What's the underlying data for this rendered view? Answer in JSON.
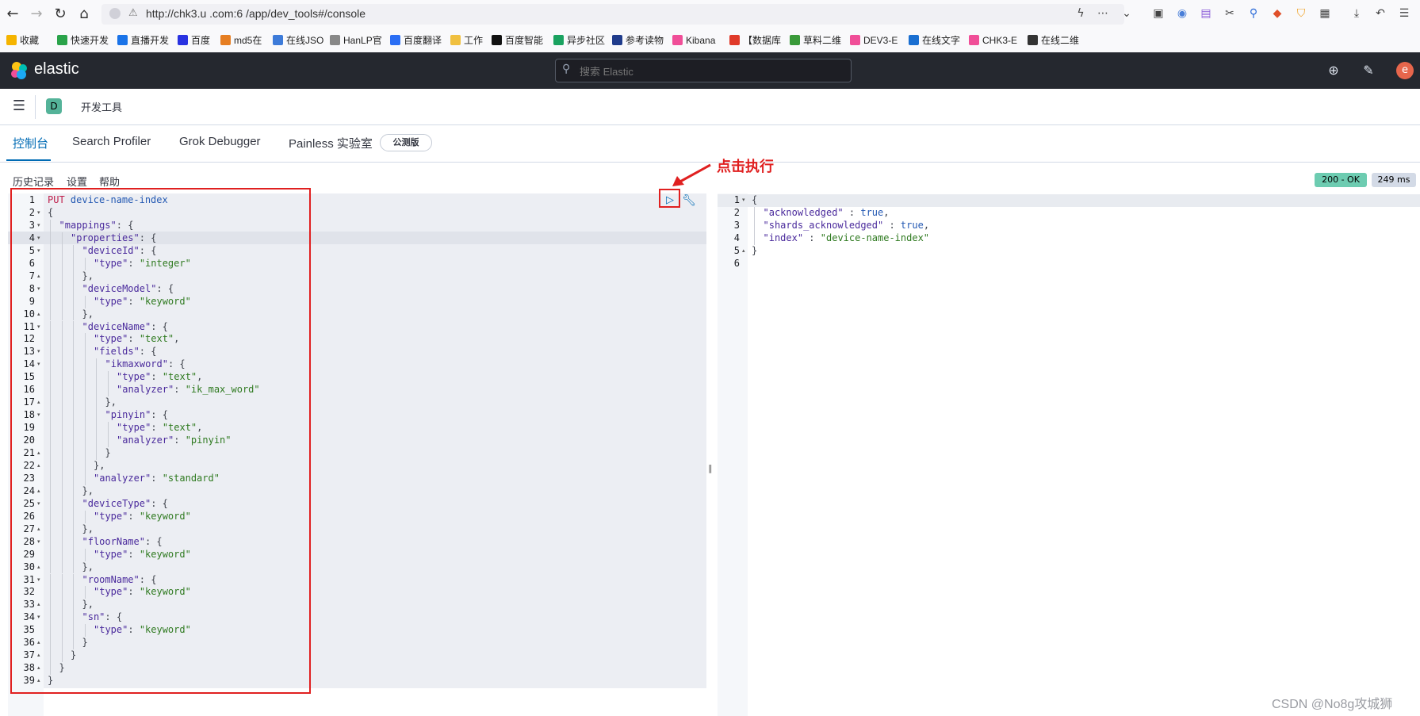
{
  "browser": {
    "back": "←",
    "forward": "→",
    "reload": "↻",
    "home": "⌂",
    "url": "http://chk3.u    .com:6   /app/dev_tools#/console",
    "toolbar_icons": [
      "bolt-icon",
      "more-icon",
      "chevron-down-icon",
      "pocket-icon",
      "extension-icon",
      "extension-icon",
      "scissors-icon",
      "search-icon",
      "game-icon",
      "shield-icon",
      "grid-icon",
      "download-icon",
      "undo-icon",
      "menu-icon"
    ]
  },
  "bookmarks": [
    {
      "label": "收藏",
      "icon": "star-icon",
      "color": "#f5b400"
    },
    {
      "label": "快速开发",
      "icon": "leaf-icon",
      "color": "#2aa34a"
    },
    {
      "label": "直播开发",
      "icon": "bookmark-icon",
      "color": "#1a73e8"
    },
    {
      "label": "百度",
      "icon": "baidu-icon",
      "color": "#2932e1"
    },
    {
      "label": "md5在",
      "icon": "bookmark-icon",
      "color": "#e67e22"
    },
    {
      "label": "在线JSO",
      "icon": "bookmark-icon",
      "color": "#3d7bd9"
    },
    {
      "label": "HanLP官",
      "icon": "bookmark-icon",
      "color": "#888888"
    },
    {
      "label": "百度翻译",
      "icon": "bookmark-icon",
      "color": "#2b6ef4"
    },
    {
      "label": "工作",
      "icon": "folder-icon",
      "color": "#f0c040"
    },
    {
      "label": "百度智能",
      "icon": "bookmark-icon",
      "color": "#111111"
    },
    {
      "label": "异步社区",
      "icon": "bookmark-icon",
      "color": "#1aa260"
    },
    {
      "label": "参考读物",
      "icon": "bookmark-icon",
      "color": "#203c8c"
    },
    {
      "label": "Kibana",
      "icon": "elastic-icon",
      "color": "#f04e98"
    },
    {
      "label": "【数据库",
      "icon": "bookmark-icon",
      "color": "#e03a2a"
    },
    {
      "label": "草料二维",
      "icon": "bookmark-icon",
      "color": "#3a9a3a"
    },
    {
      "label": "DEV3-E",
      "icon": "elastic-icon",
      "color": "#f04e98"
    },
    {
      "label": "在线文字",
      "icon": "bookmark-icon",
      "color": "#1a6fd1"
    },
    {
      "label": "CHK3-E",
      "icon": "elastic-icon",
      "color": "#f04e98"
    },
    {
      "label": "在线二维",
      "icon": "bookmark-icon",
      "color": "#333333"
    }
  ],
  "header": {
    "logo_text": "elastic",
    "search_placeholder": "搜索 Elastic"
  },
  "breadcrumb": {
    "space_initial": "D",
    "title": "开发工具"
  },
  "tabs": [
    {
      "label": "控制台",
      "active": true
    },
    {
      "label": "Search Profiler",
      "active": false
    },
    {
      "label": "Grok Debugger",
      "active": false
    },
    {
      "label": "Painless 实验室",
      "active": false
    }
  ],
  "beta_badge": "公测版",
  "console_toolbar": {
    "history": "历史记录",
    "settings": "设置",
    "help": "帮助"
  },
  "status": {
    "code": "200 - OK",
    "time": "249 ms"
  },
  "request_lines": [
    {
      "n": "1",
      "fold": "",
      "indent": 0,
      "tokens": [
        [
          "m",
          "PUT"
        ],
        [
          "b",
          " device-name-index"
        ]
      ]
    },
    {
      "n": "2",
      "fold": "▾",
      "indent": 0,
      "tokens": [
        [
          "p",
          "{"
        ]
      ]
    },
    {
      "n": "3",
      "fold": "▾",
      "indent": 1,
      "tokens": [
        [
          "k",
          "\"mappings\""
        ],
        [
          "p",
          ": {"
        ]
      ]
    },
    {
      "n": "4",
      "fold": "▾",
      "indent": 2,
      "tokens": [
        [
          "k",
          "\"properties\""
        ],
        [
          "p",
          ": {"
        ]
      ]
    },
    {
      "n": "5",
      "fold": "▾",
      "indent": 3,
      "tokens": [
        [
          "k",
          "\"deviceId\""
        ],
        [
          "p",
          ": {"
        ]
      ]
    },
    {
      "n": "6",
      "fold": "",
      "indent": 4,
      "tokens": [
        [
          "k",
          "\"type\""
        ],
        [
          "p",
          ": "
        ],
        [
          "s",
          "\"integer\""
        ]
      ]
    },
    {
      "n": "7",
      "fold": "▴",
      "indent": 3,
      "tokens": [
        [
          "p",
          "},"
        ]
      ]
    },
    {
      "n": "8",
      "fold": "▾",
      "indent": 3,
      "tokens": [
        [
          "k",
          "\"deviceModel\""
        ],
        [
          "p",
          ": {"
        ]
      ]
    },
    {
      "n": "9",
      "fold": "",
      "indent": 4,
      "tokens": [
        [
          "k",
          "\"type\""
        ],
        [
          "p",
          ": "
        ],
        [
          "s",
          "\"keyword\""
        ]
      ]
    },
    {
      "n": "10",
      "fold": "▴",
      "indent": 3,
      "tokens": [
        [
          "p",
          "},"
        ]
      ]
    },
    {
      "n": "11",
      "fold": "▾",
      "indent": 3,
      "tokens": [
        [
          "k",
          "\"deviceName\""
        ],
        [
          "p",
          ": {"
        ]
      ]
    },
    {
      "n": "12",
      "fold": "",
      "indent": 4,
      "tokens": [
        [
          "k",
          "\"type\""
        ],
        [
          "p",
          ": "
        ],
        [
          "s",
          "\"text\""
        ],
        [
          "p",
          ","
        ]
      ]
    },
    {
      "n": "13",
      "fold": "▾",
      "indent": 4,
      "tokens": [
        [
          "k",
          "\"fields\""
        ],
        [
          "p",
          ": {"
        ]
      ]
    },
    {
      "n": "14",
      "fold": "▾",
      "indent": 5,
      "tokens": [
        [
          "k",
          "\"ikmaxword\""
        ],
        [
          "p",
          ": {"
        ]
      ]
    },
    {
      "n": "15",
      "fold": "",
      "indent": 6,
      "tokens": [
        [
          "k",
          "\"type\""
        ],
        [
          "p",
          ": "
        ],
        [
          "s",
          "\"text\""
        ],
        [
          "p",
          ","
        ]
      ]
    },
    {
      "n": "16",
      "fold": "",
      "indent": 6,
      "tokens": [
        [
          "k",
          "\"analyzer\""
        ],
        [
          "p",
          ": "
        ],
        [
          "s",
          "\"ik_max_word\""
        ]
      ]
    },
    {
      "n": "17",
      "fold": "▴",
      "indent": 5,
      "tokens": [
        [
          "p",
          "},"
        ]
      ]
    },
    {
      "n": "18",
      "fold": "▾",
      "indent": 5,
      "tokens": [
        [
          "k",
          "\"pinyin\""
        ],
        [
          "p",
          ": {"
        ]
      ]
    },
    {
      "n": "19",
      "fold": "",
      "indent": 6,
      "tokens": [
        [
          "k",
          "\"type\""
        ],
        [
          "p",
          ": "
        ],
        [
          "s",
          "\"text\""
        ],
        [
          "p",
          ","
        ]
      ]
    },
    {
      "n": "20",
      "fold": "",
      "indent": 6,
      "tokens": [
        [
          "k",
          "\"analyzer\""
        ],
        [
          "p",
          ": "
        ],
        [
          "s",
          "\"pinyin\""
        ]
      ]
    },
    {
      "n": "21",
      "fold": "▴",
      "indent": 5,
      "tokens": [
        [
          "p",
          "}"
        ]
      ]
    },
    {
      "n": "22",
      "fold": "▴",
      "indent": 4,
      "tokens": [
        [
          "p",
          "},"
        ]
      ]
    },
    {
      "n": "23",
      "fold": "",
      "indent": 4,
      "tokens": [
        [
          "k",
          "\"analyzer\""
        ],
        [
          "p",
          ": "
        ],
        [
          "s",
          "\"standard\""
        ]
      ]
    },
    {
      "n": "24",
      "fold": "▴",
      "indent": 3,
      "tokens": [
        [
          "p",
          "},"
        ]
      ]
    },
    {
      "n": "25",
      "fold": "▾",
      "indent": 3,
      "tokens": [
        [
          "k",
          "\"deviceType\""
        ],
        [
          "p",
          ": {"
        ]
      ]
    },
    {
      "n": "26",
      "fold": "",
      "indent": 4,
      "tokens": [
        [
          "k",
          "\"type\""
        ],
        [
          "p",
          ": "
        ],
        [
          "s",
          "\"keyword\""
        ]
      ]
    },
    {
      "n": "27",
      "fold": "▴",
      "indent": 3,
      "tokens": [
        [
          "p",
          "},"
        ]
      ]
    },
    {
      "n": "28",
      "fold": "▾",
      "indent": 3,
      "tokens": [
        [
          "k",
          "\"floorName\""
        ],
        [
          "p",
          ": {"
        ]
      ]
    },
    {
      "n": "29",
      "fold": "",
      "indent": 4,
      "tokens": [
        [
          "k",
          "\"type\""
        ],
        [
          "p",
          ": "
        ],
        [
          "s",
          "\"keyword\""
        ]
      ]
    },
    {
      "n": "30",
      "fold": "▴",
      "indent": 3,
      "tokens": [
        [
          "p",
          "},"
        ]
      ]
    },
    {
      "n": "31",
      "fold": "▾",
      "indent": 3,
      "tokens": [
        [
          "k",
          "\"roomName\""
        ],
        [
          "p",
          ": {"
        ]
      ]
    },
    {
      "n": "32",
      "fold": "",
      "indent": 4,
      "tokens": [
        [
          "k",
          "\"type\""
        ],
        [
          "p",
          ": "
        ],
        [
          "s",
          "\"keyword\""
        ]
      ]
    },
    {
      "n": "33",
      "fold": "▴",
      "indent": 3,
      "tokens": [
        [
          "p",
          "},"
        ]
      ]
    },
    {
      "n": "34",
      "fold": "▾",
      "indent": 3,
      "tokens": [
        [
          "k",
          "\"sn\""
        ],
        [
          "p",
          ": {"
        ]
      ]
    },
    {
      "n": "35",
      "fold": "",
      "indent": 4,
      "tokens": [
        [
          "k",
          "\"type\""
        ],
        [
          "p",
          ": "
        ],
        [
          "s",
          "\"keyword\""
        ]
      ]
    },
    {
      "n": "36",
      "fold": "▴",
      "indent": 3,
      "tokens": [
        [
          "p",
          "}"
        ]
      ]
    },
    {
      "n": "37",
      "fold": "▴",
      "indent": 2,
      "tokens": [
        [
          "p",
          "}"
        ]
      ]
    },
    {
      "n": "38",
      "fold": "▴",
      "indent": 1,
      "tokens": [
        [
          "p",
          "}"
        ]
      ]
    },
    {
      "n": "39",
      "fold": "▴",
      "indent": 0,
      "tokens": [
        [
          "p",
          "}"
        ]
      ]
    }
  ],
  "response_lines": [
    {
      "n": "1",
      "fold": "▾",
      "indent": 0,
      "tokens": [
        [
          "p",
          "{"
        ]
      ]
    },
    {
      "n": "2",
      "fold": "",
      "indent": 1,
      "tokens": [
        [
          "k",
          "\"acknowledged\""
        ],
        [
          "p",
          " : "
        ],
        [
          "b",
          "true"
        ],
        [
          "p",
          ","
        ]
      ]
    },
    {
      "n": "3",
      "fold": "",
      "indent": 1,
      "tokens": [
        [
          "k",
          "\"shards_acknowledged\""
        ],
        [
          "p",
          " : "
        ],
        [
          "b",
          "true"
        ],
        [
          "p",
          ","
        ]
      ]
    },
    {
      "n": "4",
      "fold": "",
      "indent": 1,
      "tokens": [
        [
          "k",
          "\"index\""
        ],
        [
          "p",
          " : "
        ],
        [
          "s",
          "\"device-name-index\""
        ]
      ]
    },
    {
      "n": "5",
      "fold": "▴",
      "indent": 0,
      "tokens": [
        [
          "p",
          "}"
        ]
      ]
    },
    {
      "n": "6",
      "fold": "",
      "indent": 0,
      "tokens": []
    }
  ],
  "annotation": {
    "text": "点击执行"
  },
  "watermark": "CSDN @No8g攻城狮",
  "colors": {
    "accent": "#006bb4",
    "header_bg": "#25282f",
    "annotation_red": "#e02020",
    "status_ok": "#6dccb1"
  }
}
